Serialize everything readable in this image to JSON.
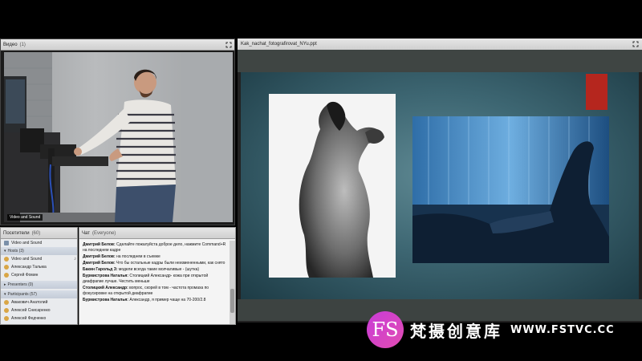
{
  "video_pod": {
    "title": "Видео",
    "count": "(1)",
    "stream_label": "Video and Sound"
  },
  "share_pod": {
    "title": "Kak_nachat_fotografirovat_NYu.ppt"
  },
  "attendees": {
    "title": "Посетители",
    "count": "(60)",
    "items": [
      {
        "label": "Video and Sound",
        "kind": "status"
      },
      {
        "label": "Hosts (3)",
        "kind": "section"
      },
      {
        "label": "Video and Sound",
        "kind": "person"
      },
      {
        "label": "Александр Тальма",
        "kind": "person"
      },
      {
        "label": "Сергей Фомин",
        "kind": "person"
      },
      {
        "label": "Presenters (0)",
        "kind": "section"
      },
      {
        "label": "Participants (57)",
        "kind": "section"
      },
      {
        "label": "Авакович Анатолий",
        "kind": "person"
      },
      {
        "label": "Алексей Снисаренко",
        "kind": "person"
      },
      {
        "label": "Алексей Федченко",
        "kind": "person"
      }
    ]
  },
  "chat": {
    "title": "Чат",
    "scope": "(Everyone)",
    "messages": [
      {
        "author": "Дмитрий Белов:",
        "text": "Сделайте пожалуйста доброе дело, нажмите Command+R на последнем кадре"
      },
      {
        "author": "Дмитрий Белов:",
        "text": "на последнем в съемке"
      },
      {
        "author": "Дмитрий Белов:",
        "text": "Что бы остальные кадры были неизмененными, как снято"
      },
      {
        "author": "Бакин Гарольд З:",
        "text": "модели всегда такие молчаливые - (шутка)"
      },
      {
        "author": "Бурмистрова Наталья:",
        "text": "Столицкий Александр- кожа при открытой диафрагме лучше. Честить меньше"
      },
      {
        "author": "Столицкий Александр:",
        "text": "вопрос, скорей в том - частота промаха по фокусировке на открытой диафрагме"
      },
      {
        "author": "Бурмистрова Наталья:",
        "text": "Александр, я пример чаще на 70-200/2.8"
      }
    ]
  },
  "watermark": {
    "logo": "FS",
    "name_cn": "梵摄创意库",
    "url": "WWW.FSTVC.CC"
  },
  "colors": {
    "slide_bg": "#3d6672",
    "accent_red": "#b5261e",
    "logo_pink": "#d845c6"
  }
}
